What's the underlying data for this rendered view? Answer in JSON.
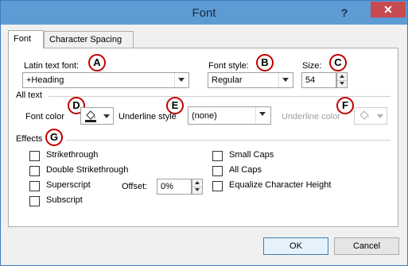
{
  "window": {
    "title": "Font",
    "help": "?",
    "close": "✕"
  },
  "tabs": [
    {
      "label": "Font",
      "active": true
    },
    {
      "label": "Character Spacing",
      "active": false
    }
  ],
  "latin_font": {
    "label": "Latin text font:",
    "value": "+Heading"
  },
  "font_style": {
    "label": "Font style:",
    "value": "Regular"
  },
  "size": {
    "label": "Size:",
    "value": "54"
  },
  "all_text": {
    "section_label": "All text"
  },
  "font_color": {
    "label": "Font color"
  },
  "underline_style": {
    "label": "Underline style",
    "value": "(none)"
  },
  "underline_color": {
    "label": "Underline color"
  },
  "effects": {
    "section_label": "Effects",
    "strikethrough": "Strikethrough",
    "double_strikethrough": "Double Strikethrough",
    "superscript": "Superscript",
    "subscript": "Subscript",
    "offset_label": "Offset:",
    "offset_value": "0%",
    "small_caps": "Small Caps",
    "all_caps": "All Caps",
    "equalize": "Equalize Character Height"
  },
  "markers": {
    "a": "A",
    "b": "B",
    "c": "C",
    "d": "D",
    "e": "E",
    "f": "F",
    "g": "G"
  },
  "buttons": {
    "ok": "OK",
    "cancel": "Cancel"
  },
  "colors": {
    "accent_marker": "#c00000",
    "font_color_swatch": "#1f1f1f",
    "titlebar": "#5d9bd5"
  }
}
